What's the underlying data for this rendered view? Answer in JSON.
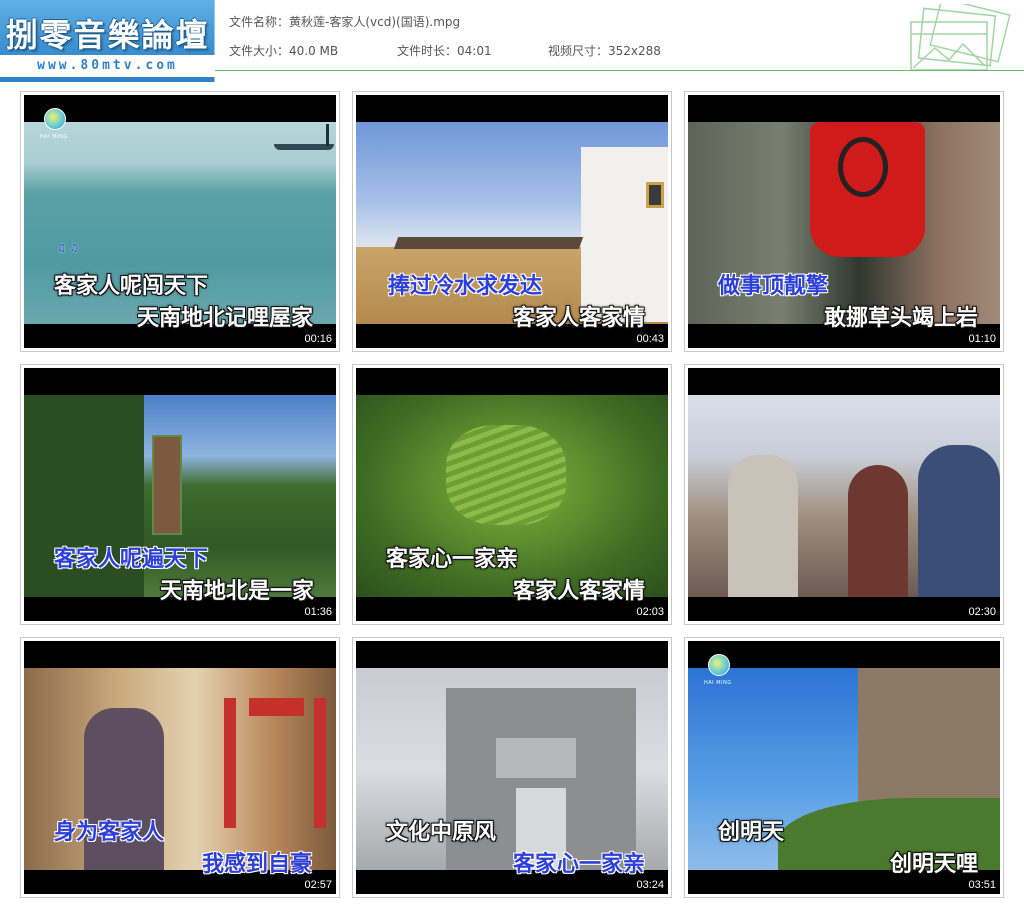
{
  "site": {
    "logo_text": "捌零音樂論壇",
    "url": "www.80mtv.com"
  },
  "file_info": {
    "name_label": "文件名称：",
    "name_value": "黄秋莲-客家人(vcd)(国语).mpg",
    "size_label": "文件大小：",
    "size_value": "40.0 MB",
    "duration_label": "文件时长：",
    "duration_value": "04:01",
    "dims_label": "视频尺寸：",
    "dims_value": "352x288"
  },
  "colors": {
    "header_line": "#64b86a",
    "logo_bg": "#3d92d3",
    "sung_text": "#2c3fd8"
  },
  "channel_logo_text": "HAI MING",
  "thumbnails": [
    {
      "time": "00:16",
      "line1": "客家人呢闯天下",
      "line2": "天南地北记哩屋家",
      "marks": "♫ ♫"
    },
    {
      "time": "00:43",
      "line1": "捧过冷水求发达",
      "line2": "客家人客家情"
    },
    {
      "time": "01:10",
      "line1": "做事顶靓擎",
      "line2": "敢挪草头竭上岩"
    },
    {
      "time": "01:36",
      "line1": "客家人呢遍天下",
      "line2": "天南地北是一家"
    },
    {
      "time": "02:03",
      "line1": "客家心一家亲",
      "line2": "客家人客家情"
    },
    {
      "time": "02:30"
    },
    {
      "time": "02:57",
      "line1": "身为客家人",
      "line2": "我感到自豪"
    },
    {
      "time": "03:24",
      "line1": "文化中原风",
      "line2": "客家心一家亲"
    },
    {
      "time": "03:51",
      "line1": "创明天",
      "line2": "创明天哩"
    }
  ]
}
